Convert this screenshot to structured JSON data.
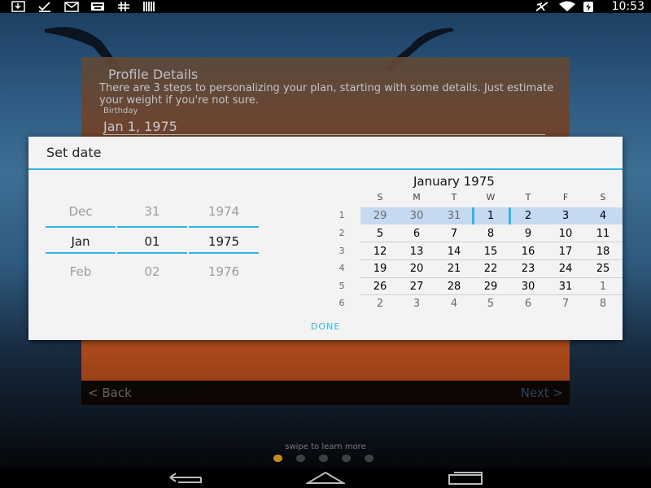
{
  "status_bar": {
    "time": "10:53",
    "icons": [
      "download-icon",
      "check-icon",
      "mail-icon",
      "keyboard-icon",
      "hashtag-icon",
      "barcode-icon",
      "airplane-icon",
      "wifi-icon",
      "battery-icon"
    ]
  },
  "profile": {
    "title": "Profile Details",
    "description": "There are 3 steps to personalizing your plan, starting with some details. Just estimate your weight if you're not sure.",
    "birthday_label": "Birthday",
    "birthday_value": "Jan 1, 1975",
    "back_label": "< Back",
    "next_label": "Next >"
  },
  "swipe_hint": "swipe to learn more",
  "page_dots": {
    "count": 5,
    "active_index": 0,
    "active_color": "#c48a1e",
    "inactive_color": "#3f3f3f"
  },
  "dialog": {
    "title": "Set date",
    "accent_color": "#33b5e5",
    "spinner": {
      "month": {
        "prev": "Dec",
        "selected": "Jan",
        "next": "Feb"
      },
      "day": {
        "prev": "31",
        "selected": "01",
        "next": "02"
      },
      "year": {
        "prev": "1974",
        "selected": "1975",
        "next": "1976"
      }
    },
    "calendar": {
      "month_title": "January 1975",
      "weekdays": [
        "S",
        "M",
        "T",
        "W",
        "T",
        "F",
        "S"
      ],
      "week_numbers": [
        "1",
        "2",
        "3",
        "4",
        "5",
        "6"
      ],
      "weeks": [
        [
          "29",
          "30",
          "31",
          "1",
          "2",
          "3",
          "4"
        ],
        [
          "5",
          "6",
          "7",
          "8",
          "9",
          "10",
          "11"
        ],
        [
          "12",
          "13",
          "14",
          "15",
          "16",
          "17",
          "18"
        ],
        [
          "19",
          "20",
          "21",
          "22",
          "23",
          "24",
          "25"
        ],
        [
          "26",
          "27",
          "28",
          "29",
          "30",
          "31",
          "1"
        ],
        [
          "2",
          "3",
          "4",
          "5",
          "6",
          "7",
          "8"
        ]
      ],
      "highlight_color": "#c5d9f1"
    },
    "done_label": "DONE"
  }
}
